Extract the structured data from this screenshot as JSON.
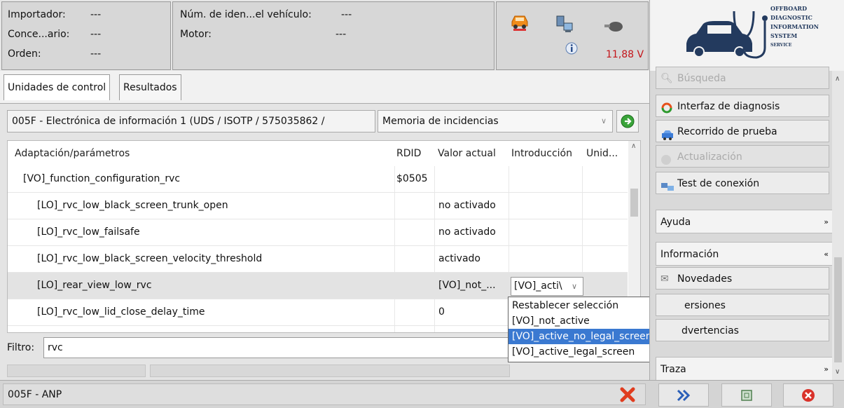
{
  "header": {
    "importer_label": "Importador:",
    "importer_value": "---",
    "dealer_label": "Conce...ario:",
    "dealer_value": "---",
    "order_label": "Orden:",
    "order_value": "---",
    "vin_label": "Núm. de iden...el vehículo:",
    "vin_value": "---",
    "engine_label": "Motor:",
    "engine_value": "---",
    "voltage": "11,88 V"
  },
  "logo": {
    "lines": [
      "Offboard",
      "Diagnostic",
      "Information",
      "System",
      "Service"
    ]
  },
  "tabs": [
    {
      "label": "Unidades de control"
    },
    {
      "label": "Resultados"
    }
  ],
  "toolbar": {
    "control_unit": "005F - Electrónica de información 1  (UDS / ISOTP / 575035862 /",
    "function_select": "Memoria de incidencias"
  },
  "grid": {
    "columns": [
      "Adaptación/parámetros",
      "RDID",
      "Valor actual",
      "Introducción",
      "Unid..."
    ],
    "rows": [
      {
        "name": "[VO]_function_configuration_rvc",
        "rdid": "$0505",
        "value": "",
        "input": "",
        "unit": ""
      },
      {
        "name": "[LO]_rvc_low_black_screen_trunk_open",
        "rdid": "",
        "value": "no activado",
        "input": "",
        "unit": ""
      },
      {
        "name": "[LO]_rvc_low_failsafe",
        "rdid": "",
        "value": "no activado",
        "input": "",
        "unit": ""
      },
      {
        "name": "[LO]_rvc_low_black_screen_velocity_threshold",
        "rdid": "",
        "value": "activado",
        "input": "",
        "unit": ""
      },
      {
        "name": "[LO]_rear_view_low_rvc",
        "rdid": "",
        "value": "[VO]_not_...",
        "input": "[VO]_acti\\",
        "unit": ""
      },
      {
        "name": "[LO]_rvc_low_lid_close_delay_time",
        "rdid": "",
        "value": "0",
        "input": "",
        "unit": ""
      }
    ]
  },
  "dropdown": {
    "options": [
      "Restablecer selección",
      "[VO]_not_active",
      "[VO]_active_no_legal_screen",
      "[VO]_active_legal_screen"
    ],
    "highlighted": 2
  },
  "filter": {
    "label": "Filtro:",
    "value": "rvc"
  },
  "right_panel": {
    "search": "Búsqueda",
    "diag_interface": "Interfaz de diagnosis",
    "test_drive": "Recorrido de prueba",
    "update": "Actualización",
    "connection_test": "Test de conexión",
    "help": "Ayuda",
    "info": "Información",
    "news": "Novedades",
    "versions": "Versiones",
    "warnings": "Advertencias",
    "trace": "Traza",
    "versions_visible": "ersiones",
    "warnings_visible": "dvertencias"
  },
  "status": {
    "control_unit": "005F - ANP"
  },
  "colors": {
    "selection_blue": "#3a79d1",
    "voltage_red": "#c4151a",
    "logo_navy": "#233a5e"
  }
}
